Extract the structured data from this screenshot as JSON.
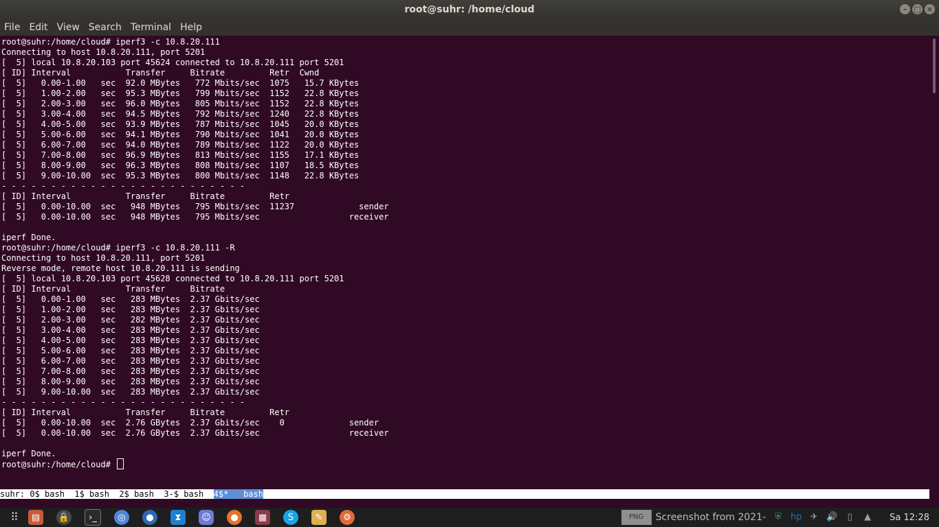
{
  "window": {
    "title": "root@suhr: /home/cloud"
  },
  "menu": [
    "File",
    "Edit",
    "View",
    "Search",
    "Terminal",
    "Help"
  ],
  "terminal": {
    "lines": [
      "root@suhr:/home/cloud# iperf3 -c 10.8.20.111",
      "Connecting to host 10.8.20.111, port 5201",
      "[  5] local 10.8.20.103 port 45624 connected to 10.8.20.111 port 5201",
      "[ ID] Interval           Transfer     Bitrate         Retr  Cwnd",
      "[  5]   0.00-1.00   sec  92.0 MBytes   772 Mbits/sec  1075   15.7 KBytes",
      "[  5]   1.00-2.00   sec  95.3 MBytes   799 Mbits/sec  1152   22.8 KBytes",
      "[  5]   2.00-3.00   sec  96.0 MBytes   805 Mbits/sec  1152   22.8 KBytes",
      "[  5]   3.00-4.00   sec  94.5 MBytes   792 Mbits/sec  1240   22.8 KBytes",
      "[  5]   4.00-5.00   sec  93.9 MBytes   787 Mbits/sec  1045   20.0 KBytes",
      "[  5]   5.00-6.00   sec  94.1 MBytes   790 Mbits/sec  1041   20.0 KBytes",
      "[  5]   6.00-7.00   sec  94.0 MBytes   789 Mbits/sec  1122   20.0 KBytes",
      "[  5]   7.00-8.00   sec  96.9 MBytes   813 Mbits/sec  1155   17.1 KBytes",
      "[  5]   8.00-9.00   sec  96.3 MBytes   808 Mbits/sec  1107   18.5 KBytes",
      "[  5]   9.00-10.00  sec  95.3 MBytes   800 Mbits/sec  1148   22.8 KBytes",
      "- - - - - - - - - - - - - - - - - - - - - - - - -",
      "[ ID] Interval           Transfer     Bitrate         Retr",
      "[  5]   0.00-10.00  sec   948 MBytes   795 Mbits/sec  11237             sender",
      "[  5]   0.00-10.00  sec   948 MBytes   795 Mbits/sec                  receiver",
      "",
      "iperf Done.",
      "root@suhr:/home/cloud# iperf3 -c 10.8.20.111 -R",
      "Connecting to host 10.8.20.111, port 5201",
      "Reverse mode, remote host 10.8.20.111 is sending",
      "[  5] local 10.8.20.103 port 45628 connected to 10.8.20.111 port 5201",
      "[ ID] Interval           Transfer     Bitrate",
      "[  5]   0.00-1.00   sec   283 MBytes  2.37 Gbits/sec",
      "[  5]   1.00-2.00   sec   283 MBytes  2.37 Gbits/sec",
      "[  5]   2.00-3.00   sec   282 MBytes  2.37 Gbits/sec",
      "[  5]   3.00-4.00   sec   283 MBytes  2.37 Gbits/sec",
      "[  5]   4.00-5.00   sec   283 MBytes  2.37 Gbits/sec",
      "[  5]   5.00-6.00   sec   283 MBytes  2.37 Gbits/sec",
      "[  5]   6.00-7.00   sec   283 MBytes  2.37 Gbits/sec",
      "[  5]   7.00-8.00   sec   283 MBytes  2.37 Gbits/sec",
      "[  5]   8.00-9.00   sec   283 MBytes  2.37 Gbits/sec",
      "[  5]   9.00-10.00  sec   283 MBytes  2.37 Gbits/sec",
      "- - - - - - - - - - - - - - - - - - - - - - - - -",
      "[ ID] Interval           Transfer     Bitrate         Retr",
      "[  5]   0.00-10.00  sec  2.76 GBytes  2.37 Gbits/sec    0             sender",
      "[  5]   0.00-10.00  sec  2.76 GBytes  2.37 Gbits/sec                  receiver",
      "",
      "iperf Done."
    ],
    "prompt": "root@suhr:/home/cloud# "
  },
  "tmux": {
    "status_left": "suhr: 0$ bash  1$ bash  2$ bash  3-$ bash  ",
    "active_window": "4$*   bash"
  },
  "taskbar": {
    "apps_icon": "grid-icon",
    "pinned": [
      "files-icon",
      "lock-icon",
      "terminal-icon",
      "chromium-icon",
      "pycharm-icon",
      "vscode-icon",
      "discord-icon",
      "firefox-icon",
      "video-icon",
      "skype-icon",
      "editor-icon",
      "settings-icon"
    ],
    "png_badge": "PNG",
    "screenshot_label": "Screenshot from 2021-",
    "clock": "Sa 12:28"
  }
}
